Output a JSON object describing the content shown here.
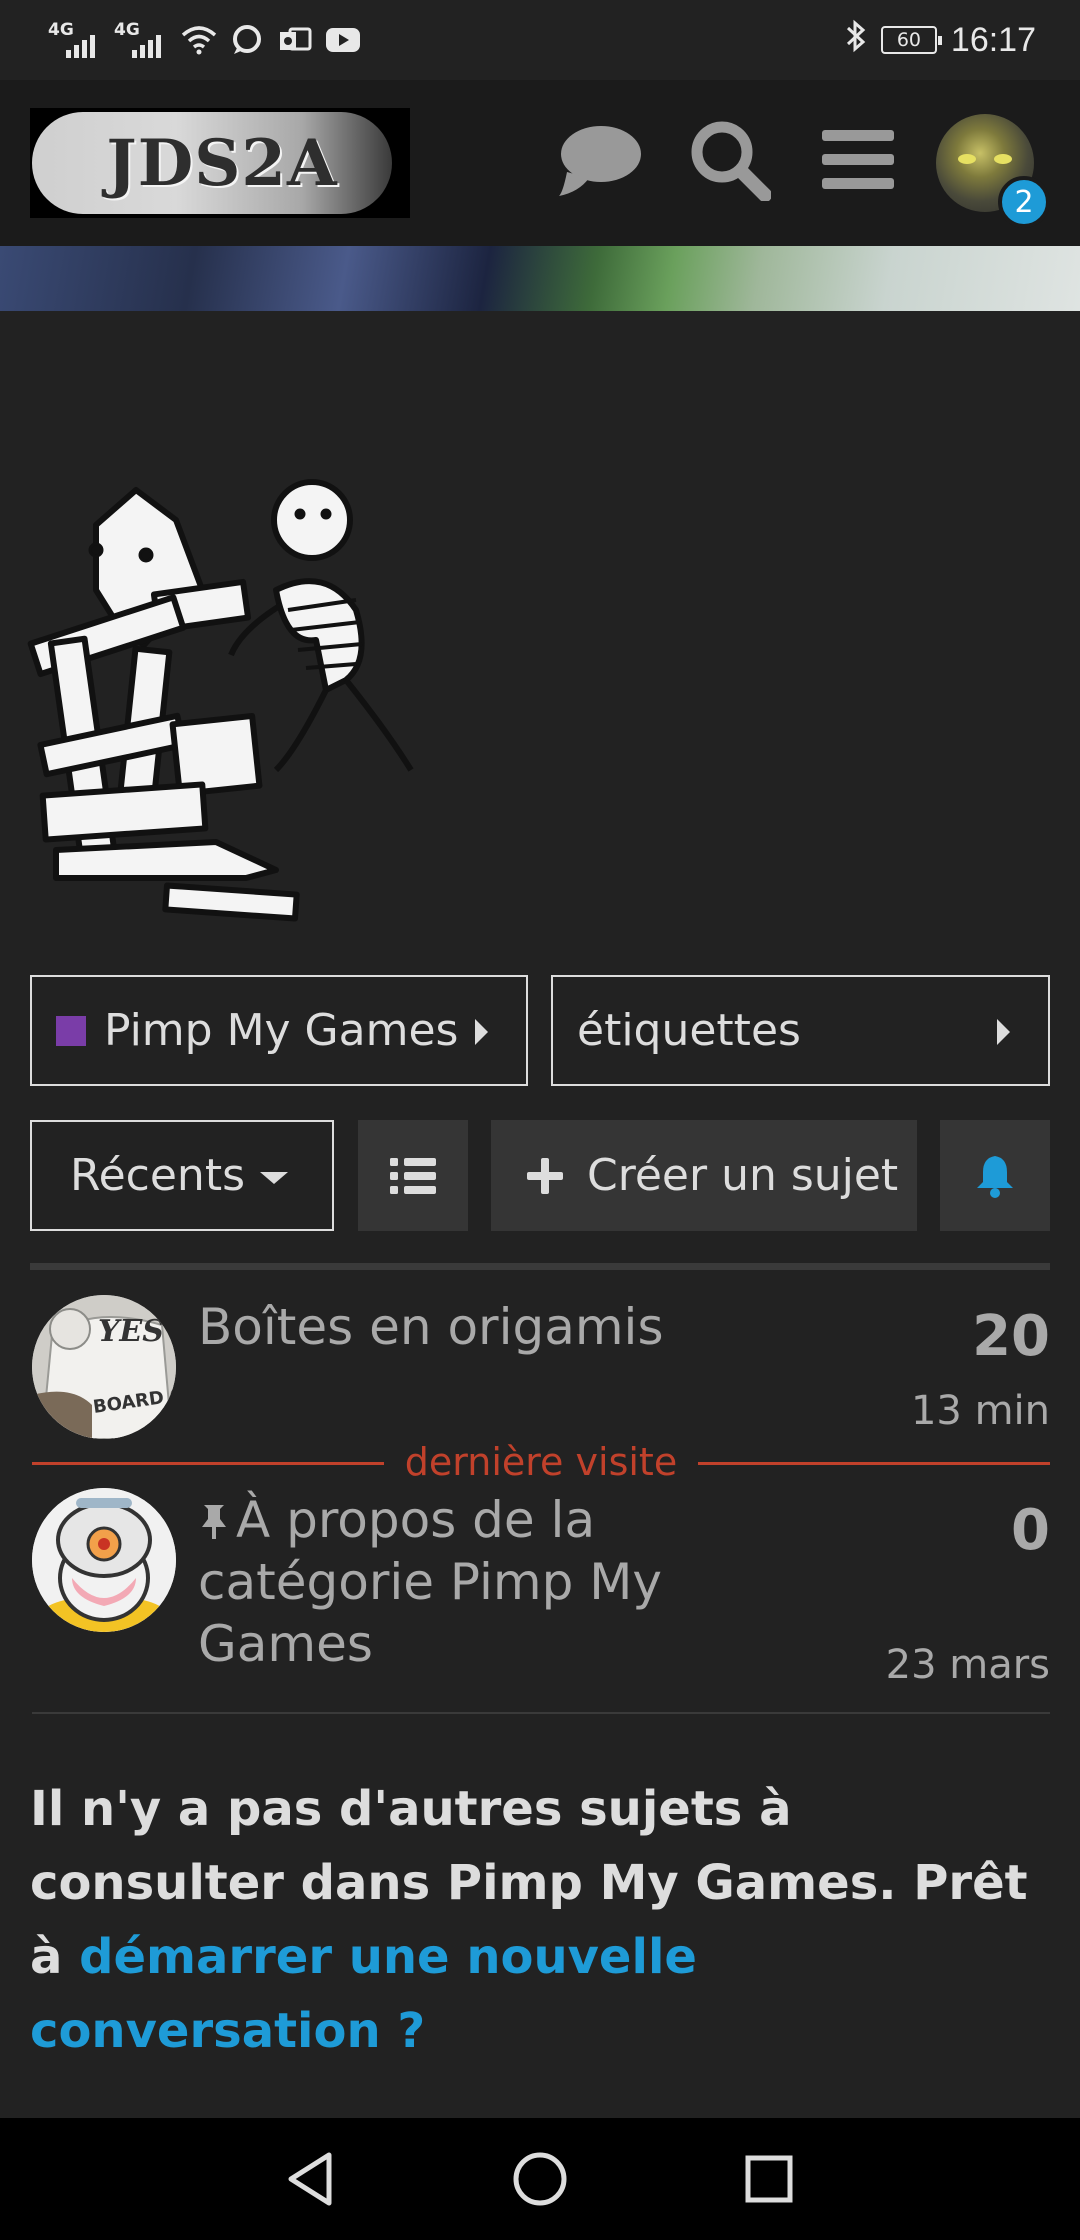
{
  "status_bar": {
    "network_1": "4G",
    "network_2": "4G",
    "battery": "60",
    "time": "16:17",
    "icons": [
      "wifi-icon",
      "chat-bubble-icon",
      "outlook-icon",
      "youtube-icon",
      "bluetooth-icon"
    ]
  },
  "header": {
    "logo_text": "JDS2A",
    "notification_count": "2",
    "icons": [
      "chat-icon",
      "search-icon",
      "hamburger-menu-icon"
    ]
  },
  "filters": {
    "category_label": "Pimp My Games",
    "category_color": "#7a3da8",
    "tags_label": "étiquettes",
    "sort_label": "Récents",
    "create_label": "Créer un sujet"
  },
  "topics": [
    {
      "title": "Boîtes en origamis",
      "count": "20",
      "time": "13 min",
      "avatar_text_1": "YES",
      "avatar_text_2": "BOARD GAME"
    },
    {
      "title": "À propos de la catégorie Pimp My Games",
      "count": "0",
      "time": "23 mars",
      "pinned": true
    }
  ],
  "last_visit_label": "dernière visite",
  "footer": {
    "message_prefix": "Il n'y a pas d'autres sujets à consulter dans Pimp My Games. Prêt à ",
    "message_link": "démarrer une nouvelle conversation ?"
  },
  "colors": {
    "accent": "#1e9bd7",
    "last_visit": "#c1412b",
    "background": "#222222"
  }
}
